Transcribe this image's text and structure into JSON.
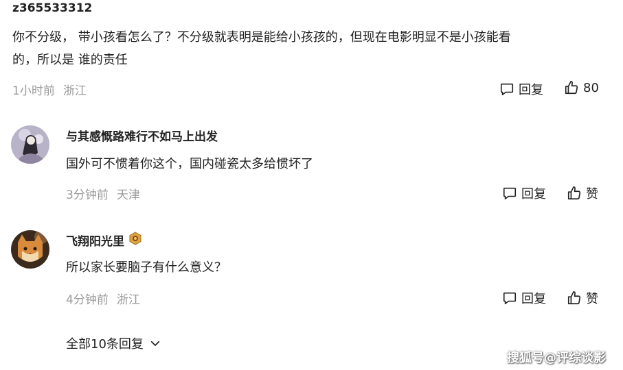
{
  "comments": [
    {
      "username": "z365533312",
      "content_line1": "你不分级， 带小孩看怎么了？不分级就表明是能给小孩孩的，但现在电影明显不是小孩能看",
      "content_line2": "的，所以是 谁的责任",
      "time": "1小时前",
      "location": "浙江",
      "reply_label": "回复",
      "like_label": "80"
    },
    {
      "username": "与其感慨路难行不如马上出发",
      "content": "国外可不惯着你这个，国内碰瓷太多给惯坏了",
      "time": "3分钟前",
      "location": "天津",
      "reply_label": "回复",
      "like_label": "赞"
    },
    {
      "username": "飞翔阳光里",
      "content": "所以家长要脑子有什么意义？",
      "time": "4分钟前",
      "location": "浙江",
      "reply_label": "回复",
      "like_label": "赞"
    }
  ],
  "expand_label": "全部10条回复",
  "watermark": "搜狐号@评综谈影"
}
